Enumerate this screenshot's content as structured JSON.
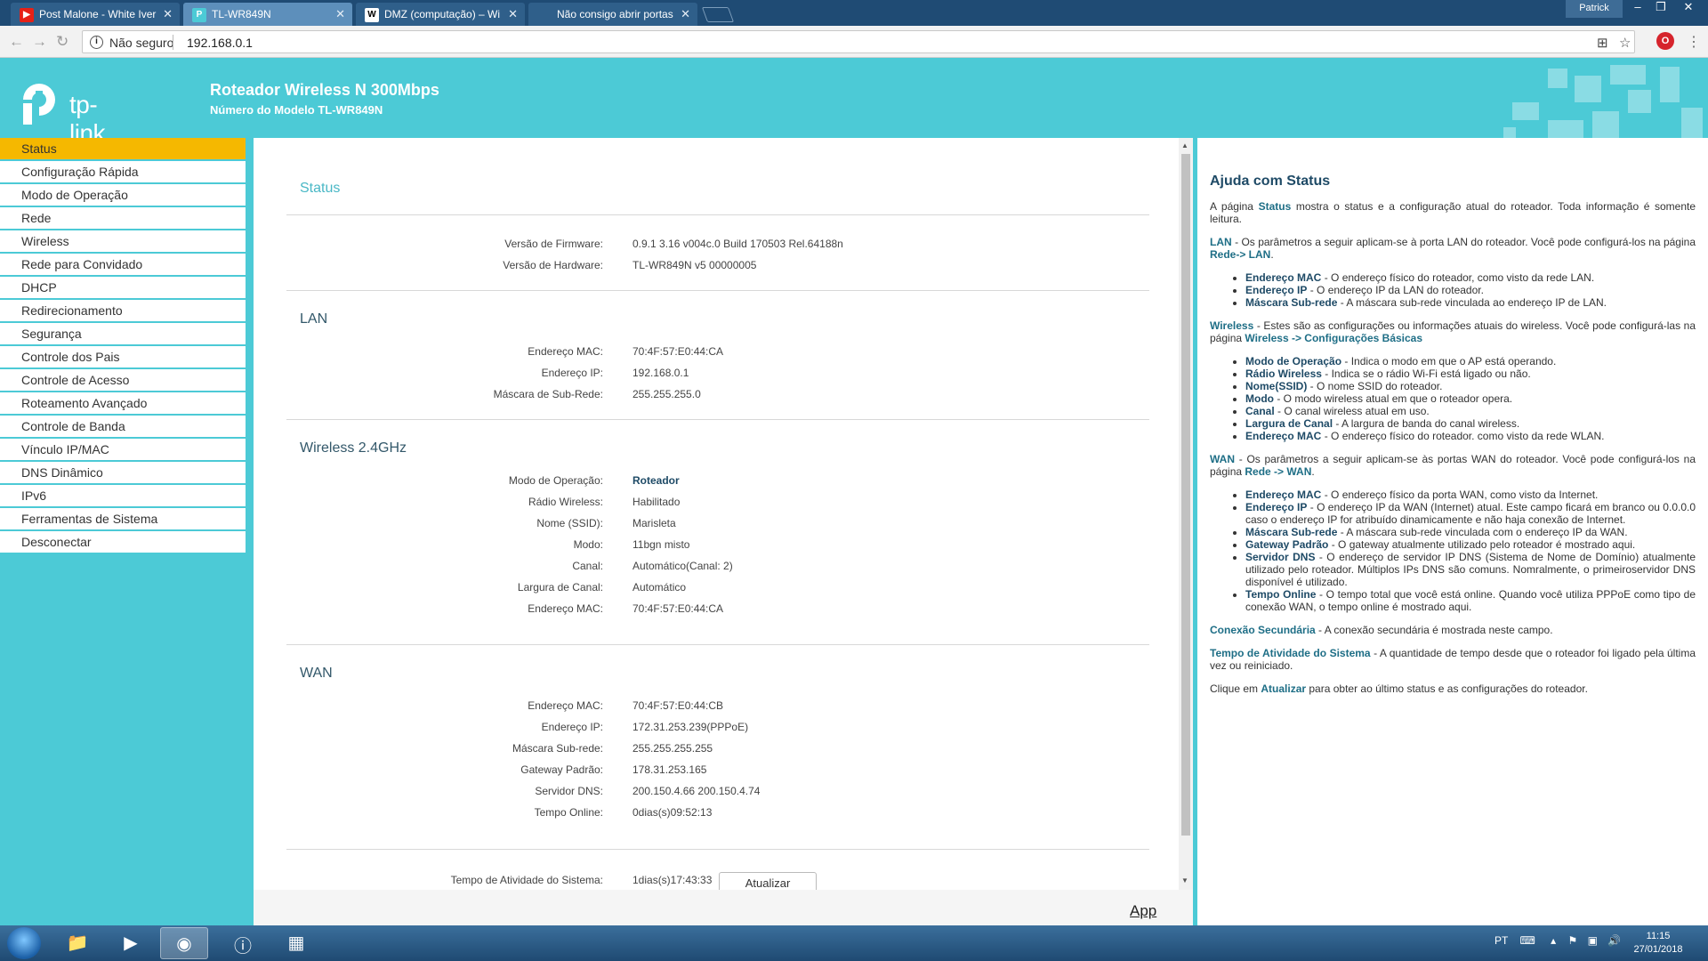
{
  "browser": {
    "tabs": [
      {
        "title": "Post Malone - White Iver",
        "icon": "youtube-icon",
        "active": false
      },
      {
        "title": "TL-WR849N",
        "icon": "tplink-icon",
        "active": true
      },
      {
        "title": "DMZ (computação) – Wi",
        "icon": "wikipedia-icon",
        "active": false
      },
      {
        "title": "Não consigo abrir portas",
        "icon": "page-icon",
        "active": false
      }
    ],
    "profile": "Patrick",
    "security_label": "Não seguro",
    "url": "192.168.0.1"
  },
  "router": {
    "brand": "tp-link",
    "title": "Roteador Wireless N 300Mbps",
    "model": "Número do Modelo TL-WR849N"
  },
  "menu": [
    "Status",
    "Configuração Rápida",
    "Modo de Operação",
    "Rede",
    "Wireless",
    "Rede para Convidado",
    "DHCP",
    "Redirecionamento",
    "Segurança",
    "Controle dos Pais",
    "Controle de Acesso",
    "Roteamento Avançado",
    "Controle de Banda",
    "Vínculo IP/MAC",
    "DNS Dinâmico",
    "IPv6",
    "Ferramentas de Sistema",
    "Desconectar"
  ],
  "status": {
    "title": "Status",
    "firmware_label": "Versão de Firmware:",
    "firmware": "0.9.1 3.16 v004c.0 Build 170503 Rel.64188n",
    "hardware_label": "Versão de Hardware:",
    "hardware": "TL-WR849N v5 00000005",
    "lan": {
      "title": "LAN",
      "mac_label": "Endereço MAC:",
      "mac": "70:4F:57:E0:44:CA",
      "ip_label": "Endereço IP:",
      "ip": "192.168.0.1",
      "mask_label": "Máscara de Sub-Rede:",
      "mask": "255.255.255.0"
    },
    "wireless": {
      "title": "Wireless 2.4GHz",
      "mode_label": "Modo de Operação:",
      "mode": "Roteador",
      "radio_label": "Rádio Wireless:",
      "radio": "Habilitado",
      "ssid_label": "Nome (SSID):",
      "ssid": "Marisleta",
      "modo_label": "Modo:",
      "modo": "11bgn misto",
      "channel_label": "Canal:",
      "channel": "Automático(Canal: 2)",
      "width_label": "Largura de Canal:",
      "width": "Automático",
      "mac_label": "Endereço MAC:",
      "mac": "70:4F:57:E0:44:CA"
    },
    "wan": {
      "title": "WAN",
      "mac_label": "Endereço MAC:",
      "mac": "70:4F:57:E0:44:CB",
      "ip_label": "Endereço IP:",
      "ip": "172.31.253.239(PPPoE)",
      "mask_label": "Máscara Sub-rede:",
      "mask": "255.255.255.255",
      "gateway_label": "Gateway Padrão:",
      "gateway": "178.31.253.165",
      "dns_label": "Servidor DNS:",
      "dns": "200.150.4.66 200.150.4.74",
      "online_label": "Tempo Online:",
      "online": "0dias(s)09:52:13"
    },
    "uptime_label": "Tempo de Atividade do Sistema:",
    "uptime": "1dias(s)17:43:33",
    "refresh_button": "Atualizar",
    "app_link": "App"
  },
  "help": {
    "title": "Ajuda com Status",
    "p1_a": "A página ",
    "p1_b": "Status",
    "p1_c": " mostra o status e a configuração atual do roteador. Toda informação é somente leitura.",
    "lan_a": "LAN",
    "lan_b": " - Os parâmetros a seguir aplicam-se à porta LAN do roteador. Você pode configurá-los na página ",
    "lan_c": "Rede-> LAN",
    "lan_d": ".",
    "lan_items": [
      [
        "Endereço MAC",
        " - O endereço físico do roteador, como visto da rede LAN."
      ],
      [
        "Endereço IP",
        " - O endereço IP da LAN do roteador."
      ],
      [
        "Máscara Sub-rede",
        " - A máscara sub-rede vinculada ao endereço IP de LAN."
      ]
    ],
    "wl_a": "Wireless",
    "wl_b": " - Estes são as configurações ou informações atuais do wireless. Você pode configurá-las na página ",
    "wl_c": "Wireless -> Configurações Básicas",
    "wl_items": [
      [
        "Modo de Operação",
        " - Indica o modo em que o AP está operando."
      ],
      [
        "Rádio Wireless",
        " - Indica se o rádio Wi-Fi está ligado ou não."
      ],
      [
        "Nome(SSID)",
        " - O nome SSID do roteador."
      ],
      [
        "Modo",
        " - O modo wireless atual em que o roteador opera."
      ],
      [
        "Canal",
        " - O canal wireless atual em uso."
      ],
      [
        "Largura de Canal",
        " - A largura de banda do canal wireless."
      ],
      [
        "Endereço MAC",
        " - O endereço físico do roteador. como visto da rede WLAN."
      ]
    ],
    "wan_a": "WAN",
    "wan_b": " - Os parâmetros a seguir aplicam-se às portas WAN do roteador. Você pode configurá-los na página ",
    "wan_c": "Rede -> WAN",
    "wan_d": ".",
    "wan_items": [
      [
        "Endereço MAC",
        " - O endereço físico da porta WAN, como visto da Internet."
      ],
      [
        "Endereço IP",
        " - O endereço IP da WAN (Internet) atual. Este campo ficará em branco ou 0.0.0.0 caso o endereço IP for atribuído dinamicamente e não haja conexão de Internet."
      ],
      [
        "Máscara Sub-rede",
        " - A máscara sub-rede vinculada com o endereço IP da WAN."
      ],
      [
        "Gateway Padrão",
        " - O gateway atualmente utilizado pelo roteador é mostrado aqui."
      ],
      [
        "Servidor DNS",
        " - O endereço de servidor IP DNS (Sistema de Nome de Domínio) atualmente utilizado pelo roteador. Múltiplos IPs DNS são comuns. Nomralmente, o primeiroservidor DNS disponível é utilizado."
      ],
      [
        "Tempo Online",
        " - O tempo total que você está online. Quando você utiliza PPPoE como tipo de conexão WAN, o tempo online é mostrado aqui."
      ]
    ],
    "sec_a": "Conexão Secundária",
    "sec_b": " - A conexão secundária é mostrada neste campo.",
    "up_a": "Tempo de Atividade do Sistema",
    "up_b": " - A quantidade de tempo desde que o roteador foi ligado pela última vez ou reiniciado.",
    "cl_a": "Clique em ",
    "cl_b": "Atualizar",
    "cl_c": " para obter ao último status e as configurações do roteador."
  },
  "taskbar": {
    "language": "PT",
    "time": "11:15",
    "date": "27/01/2018"
  }
}
